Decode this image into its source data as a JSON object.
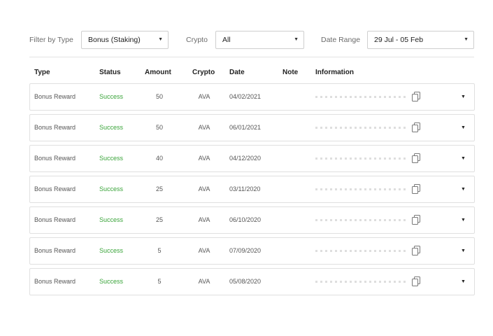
{
  "filters": {
    "type_label": "Filter by Type",
    "type_value": "Bonus (Staking)",
    "crypto_label": "Crypto",
    "crypto_value": "All",
    "date_label": "Date Range",
    "date_value": "29 Jul - 05 Feb"
  },
  "columns": [
    "Type",
    "Status",
    "Amount",
    "Crypto",
    "Date",
    "Note",
    "Information"
  ],
  "rows": [
    {
      "type": "Bonus Reward",
      "status": "Success",
      "amount": "50",
      "crypto": "AVA",
      "date": "04/02/2021"
    },
    {
      "type": "Bonus Reward",
      "status": "Success",
      "amount": "50",
      "crypto": "AVA",
      "date": "06/01/2021"
    },
    {
      "type": "Bonus Reward",
      "status": "Success",
      "amount": "40",
      "crypto": "AVA",
      "date": "04/12/2020"
    },
    {
      "type": "Bonus Reward",
      "status": "Success",
      "amount": "25",
      "crypto": "AVA",
      "date": "03/11/2020"
    },
    {
      "type": "Bonus Reward",
      "status": "Success",
      "amount": "25",
      "crypto": "AVA",
      "date": "06/10/2020"
    },
    {
      "type": "Bonus Reward",
      "status": "Success",
      "amount": "5",
      "crypto": "AVA",
      "date": "07/09/2020"
    },
    {
      "type": "Bonus Reward",
      "status": "Success",
      "amount": "5",
      "crypto": "AVA",
      "date": "05/08/2020"
    }
  ],
  "colors": {
    "success": "#3aa43a",
    "border": "#e0e0e0"
  },
  "icons": {
    "copy": "copy-icon",
    "caret": "chevron-down-icon"
  }
}
